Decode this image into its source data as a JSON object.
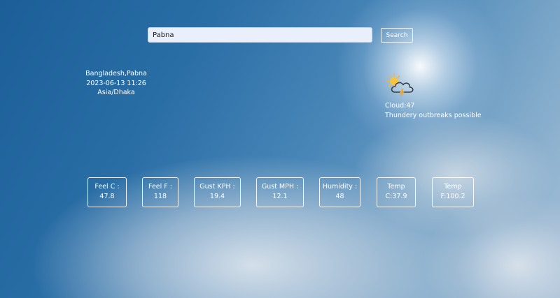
{
  "search": {
    "value": "Pabna",
    "button_label": "Search"
  },
  "location": {
    "place": "Bangladesh,Pabna",
    "datetime": "2023-06-13 11:26",
    "timezone": "Asia/Dhaka"
  },
  "current": {
    "icon": "thunder-sun-cloud-icon",
    "cloud": "Cloud:47",
    "condition": "Thundery outbreaks possible"
  },
  "stats": [
    {
      "label": "Feel C :",
      "value": "47.8"
    },
    {
      "label": "Feel F :",
      "value": "118"
    },
    {
      "label": "Gust KPH :",
      "value": "19.4"
    },
    {
      "label": "Gust MPH :",
      "value": "12.1"
    },
    {
      "label": "Humidity :",
      "value": "48"
    },
    {
      "label": "Temp",
      "value": "C:37.9"
    },
    {
      "label": "Temp",
      "value": "F:100.2"
    }
  ],
  "colors": {
    "sky": "#2a6ea6",
    "search_bg": "#e9f0fc",
    "text": "#ffffff"
  }
}
